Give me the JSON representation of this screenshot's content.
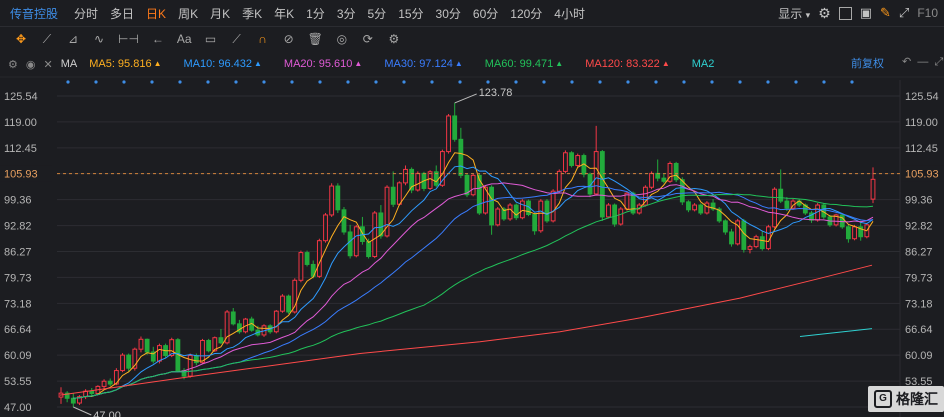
{
  "toolbar": {
    "stock_name": "传音控股",
    "periods": [
      "分时",
      "多日",
      "日K",
      "周K",
      "月K",
      "季K",
      "年K",
      "1分",
      "3分",
      "5分",
      "15分",
      "30分",
      "60分",
      "120分",
      "4小时"
    ],
    "active_period": "日K",
    "display_label": "显示",
    "f10_label": "F10"
  },
  "ma_row": {
    "name": "MA",
    "items": [
      {
        "label": "MA5: 95.816",
        "color": "#ffb020",
        "trend": "▲"
      },
      {
        "label": "MA10: 96.432",
        "color": "#2e9bff",
        "trend": "▲"
      },
      {
        "label": "MA20: 95.610",
        "color": "#e05bd6",
        "trend": "▲"
      },
      {
        "label": "MA30: 97.124",
        "color": "#3a7dff",
        "trend": "▲"
      },
      {
        "label": "MA60: 99.471",
        "color": "#22c25a",
        "trend": "▲"
      },
      {
        "label": "MA120: 83.322",
        "color": "#ff4a4a",
        "trend": "▲"
      },
      {
        "label": "MA2",
        "color": "#2fd0d0",
        "trend": ""
      }
    ],
    "adjust_label": "前复权"
  },
  "watermark": "格隆汇",
  "colors": {
    "up": "#f23645",
    "down": "#22ab3c",
    "bg": "#1c1d21",
    "grid": "#2c2d32",
    "price_line": "#d2843b"
  },
  "chart_data": {
    "type": "candlestick",
    "y_ticks": [
      125.54,
      119.0,
      112.45,
      105.93,
      99.36,
      92.82,
      86.27,
      79.73,
      73.18,
      66.64,
      60.09,
      53.55,
      47.0
    ],
    "ylim": [
      47.0,
      125.54
    ],
    "current_price": 105.93,
    "high_label": "123.78",
    "low_label": "47.00",
    "ohlc": [
      [
        49.5,
        52.0,
        47.8,
        50.5
      ],
      [
        50.5,
        51.0,
        48.2,
        49.2
      ],
      [
        49.2,
        50.4,
        47.0,
        48.0
      ],
      [
        48.0,
        50.0,
        47.5,
        49.6
      ],
      [
        49.6,
        51.5,
        49.0,
        51.0
      ],
      [
        51.0,
        51.8,
        49.9,
        50.4
      ],
      [
        50.4,
        52.5,
        50.0,
        52.2
      ],
      [
        52.2,
        54.0,
        51.5,
        53.5
      ],
      [
        53.5,
        54.2,
        52.3,
        52.8
      ],
      [
        52.8,
        56.8,
        52.5,
        56.2
      ],
      [
        56.2,
        60.6,
        55.8,
        60.1
      ],
      [
        60.1,
        60.5,
        56.0,
        56.8
      ],
      [
        56.8,
        62.0,
        56.2,
        61.6
      ],
      [
        61.6,
        64.8,
        60.8,
        64.1
      ],
      [
        64.1,
        64.3,
        60.2,
        60.9
      ],
      [
        60.9,
        62.2,
        58.0,
        58.6
      ],
      [
        58.6,
        63.0,
        58.0,
        62.5
      ],
      [
        62.5,
        63.0,
        59.5,
        60.0
      ],
      [
        60.0,
        64.5,
        59.6,
        64.0
      ],
      [
        64.0,
        64.4,
        55.8,
        56.2
      ],
      [
        56.2,
        56.8,
        54.0,
        54.8
      ],
      [
        54.8,
        60.5,
        54.4,
        60.0
      ],
      [
        60.0,
        60.5,
        57.5,
        58.2
      ],
      [
        58.2,
        64.2,
        57.8,
        63.8
      ],
      [
        63.8,
        64.2,
        60.8,
        61.2
      ],
      [
        61.2,
        64.8,
        60.9,
        64.5
      ],
      [
        64.5,
        66.7,
        62.9,
        63.2
      ],
      [
        63.2,
        71.5,
        62.8,
        71.0
      ],
      [
        71.0,
        72.0,
        67.6,
        68.0
      ],
      [
        68.0,
        69.0,
        65.5,
        66.0
      ],
      [
        66.0,
        69.5,
        65.6,
        69.2
      ],
      [
        69.2,
        69.8,
        66.0,
        66.4
      ],
      [
        66.4,
        67.5,
        64.8,
        65.2
      ],
      [
        65.2,
        67.9,
        64.7,
        67.5
      ],
      [
        67.5,
        67.9,
        65.5,
        66.0
      ],
      [
        66.0,
        71.5,
        65.6,
        71.2
      ],
      [
        71.2,
        75.5,
        70.8,
        75.0
      ],
      [
        75.0,
        75.4,
        70.5,
        71.0
      ],
      [
        71.0,
        79.5,
        70.6,
        79.0
      ],
      [
        79.0,
        86.5,
        78.5,
        86.0
      ],
      [
        86.0,
        86.5,
        82.5,
        83.0
      ],
      [
        83.0,
        84.0,
        79.5,
        80.0
      ],
      [
        80.0,
        89.5,
        79.6,
        89.0
      ],
      [
        89.0,
        96.0,
        88.5,
        95.5
      ],
      [
        95.5,
        103.5,
        95.0,
        102.8
      ],
      [
        102.8,
        103.5,
        96.0,
        96.8
      ],
      [
        96.8,
        97.5,
        90.5,
        91.2
      ],
      [
        91.2,
        93.0,
        84.5,
        85.2
      ],
      [
        85.2,
        93.0,
        84.8,
        92.5
      ],
      [
        92.5,
        95.0,
        88.0,
        88.8
      ],
      [
        88.8,
        89.5,
        84.5,
        85.0
      ],
      [
        85.0,
        96.5,
        84.6,
        96.0
      ],
      [
        96.0,
        98.0,
        89.5,
        90.2
      ],
      [
        90.2,
        103.0,
        89.8,
        102.5
      ],
      [
        102.5,
        106.5,
        97.5,
        98.2
      ],
      [
        98.2,
        104.0,
        97.8,
        103.6
      ],
      [
        103.6,
        108.0,
        103.0,
        107.0
      ],
      [
        107.0,
        107.5,
        101.0,
        101.8
      ],
      [
        101.8,
        106.5,
        101.4,
        106.0
      ],
      [
        106.0,
        106.4,
        101.5,
        102.2
      ],
      [
        102.2,
        106.8,
        101.8,
        106.4
      ],
      [
        106.4,
        108.0,
        102.5,
        103.0
      ],
      [
        103.0,
        112.0,
        102.6,
        111.5
      ],
      [
        111.5,
        121.0,
        111.0,
        120.5
      ],
      [
        120.5,
        123.78,
        114.0,
        114.6
      ],
      [
        114.6,
        117.5,
        104.8,
        105.5
      ],
      [
        105.5,
        106.0,
        100.0,
        100.6
      ],
      [
        100.6,
        106.0,
        100.2,
        105.5
      ],
      [
        105.5,
        105.9,
        95.5,
        96.0
      ],
      [
        96.0,
        103.0,
        95.6,
        102.5
      ],
      [
        102.5,
        103.0,
        90.5,
        93.0
      ],
      [
        93.0,
        97.5,
        92.6,
        97.0
      ],
      [
        97.0,
        97.5,
        94.0,
        94.5
      ],
      [
        94.5,
        98.5,
        94.0,
        98.0
      ],
      [
        98.0,
        98.4,
        94.2,
        94.8
      ],
      [
        94.8,
        99.5,
        94.4,
        99.0
      ],
      [
        99.0,
        99.4,
        95.2,
        95.6
      ],
      [
        95.6,
        96.0,
        90.5,
        91.5
      ],
      [
        91.5,
        99.5,
        91.0,
        99.0
      ],
      [
        99.0,
        99.5,
        93.5,
        94.0
      ],
      [
        94.0,
        102.0,
        93.6,
        101.5
      ],
      [
        101.5,
        107.0,
        101.0,
        106.5
      ],
      [
        106.5,
        111.8,
        106.0,
        111.2
      ],
      [
        111.2,
        111.6,
        107.5,
        108.0
      ],
      [
        108.0,
        111.0,
        107.6,
        110.5
      ],
      [
        110.5,
        111.0,
        105.0,
        105.8
      ],
      [
        105.8,
        106.2,
        100.0,
        100.8
      ],
      [
        100.8,
        118.0,
        100.4,
        111.5
      ],
      [
        111.5,
        111.9,
        94.0,
        95.0
      ],
      [
        95.0,
        98.5,
        94.6,
        98.0
      ],
      [
        98.0,
        98.4,
        92.5,
        93.2
      ],
      [
        93.2,
        97.5,
        92.8,
        97.0
      ],
      [
        97.0,
        101.5,
        96.6,
        101.0
      ],
      [
        101.0,
        101.4,
        95.5,
        96.0
      ],
      [
        96.0,
        98.5,
        95.6,
        98.0
      ],
      [
        98.0,
        103.0,
        97.6,
        102.5
      ],
      [
        102.5,
        106.5,
        102.0,
        106.0
      ],
      [
        106.0,
        109.5,
        104.0,
        104.8
      ],
      [
        104.8,
        106.0,
        103.5,
        104.0
      ],
      [
        104.0,
        109.0,
        103.6,
        108.5
      ],
      [
        108.5,
        108.9,
        103.8,
        104.4
      ],
      [
        104.4,
        105.0,
        98.0,
        98.8
      ],
      [
        98.8,
        99.2,
        96.2,
        96.8
      ],
      [
        96.8,
        98.5,
        96.4,
        98.0
      ],
      [
        98.0,
        98.4,
        95.5,
        96.0
      ],
      [
        96.0,
        99.0,
        95.6,
        98.5
      ],
      [
        98.5,
        99.5,
        96.5,
        97.0
      ],
      [
        97.0,
        97.5,
        93.5,
        94.0
      ],
      [
        94.0,
        94.4,
        90.5,
        91.2
      ],
      [
        91.2,
        92.0,
        87.5,
        88.2
      ],
      [
        88.2,
        94.5,
        87.8,
        94.0
      ],
      [
        94.0,
        94.5,
        86.0,
        86.8
      ],
      [
        86.8,
        88.0,
        85.8,
        87.5
      ],
      [
        87.5,
        90.5,
        87.1,
        90.0
      ],
      [
        90.0,
        91.5,
        86.5,
        87.0
      ],
      [
        87.0,
        93.0,
        86.6,
        92.5
      ],
      [
        92.5,
        102.5,
        92.1,
        102.0
      ],
      [
        102.0,
        107.0,
        98.5,
        99.0
      ],
      [
        99.0,
        100.0,
        96.5,
        97.2
      ],
      [
        97.2,
        99.5,
        96.8,
        99.0
      ],
      [
        99.0,
        99.4,
        97.5,
        98.0
      ],
      [
        98.0,
        98.4,
        95.5,
        96.0
      ],
      [
        96.0,
        96.5,
        93.5,
        94.2
      ],
      [
        94.2,
        98.5,
        93.8,
        98.0
      ],
      [
        98.0,
        98.4,
        94.5,
        95.0
      ],
      [
        95.0,
        95.5,
        92.5,
        93.0
      ],
      [
        93.0,
        95.8,
        92.6,
        95.5
      ],
      [
        95.5,
        95.9,
        92.0,
        92.5
      ],
      [
        92.5,
        93.0,
        88.5,
        89.5
      ],
      [
        89.5,
        93.0,
        89.1,
        92.5
      ],
      [
        92.5,
        94.0,
        89.0,
        90.0
      ],
      [
        90.0,
        93.5,
        89.6,
        93.0
      ],
      [
        99.5,
        107.5,
        98.5,
        104.5
      ]
    ],
    "ma120_line": [
      [
        60,
        50.0
      ],
      [
        200,
        55.0
      ],
      [
        360,
        60.5
      ],
      [
        480,
        63.5
      ],
      [
        560,
        66.0
      ],
      [
        640,
        69.5
      ],
      [
        740,
        74.5
      ],
      [
        820,
        79.5
      ],
      [
        872,
        82.8
      ]
    ],
    "ma250_line": [
      [
        800,
        64.8
      ],
      [
        872,
        66.8
      ]
    ]
  }
}
